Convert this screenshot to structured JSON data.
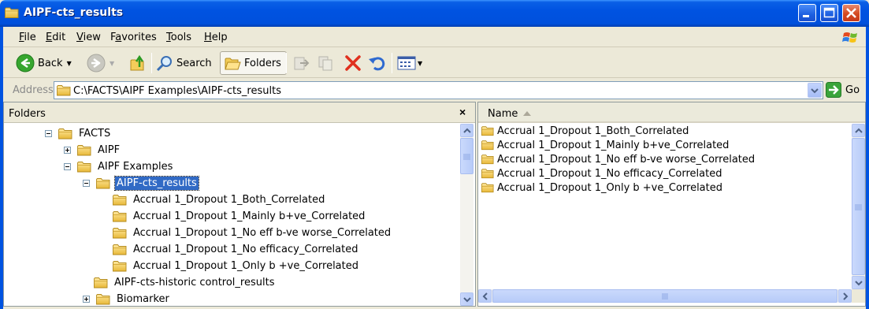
{
  "window": {
    "title": "AIPF-cts_results"
  },
  "menu": [
    "File",
    "Edit",
    "View",
    "Favorites",
    "Tools",
    "Help"
  ],
  "menu_underline": [
    "F",
    "E",
    "V",
    "a",
    "T",
    "H"
  ],
  "toolbar": {
    "back_label": "Back",
    "search_label": "Search",
    "folders_label": "Folders"
  },
  "address": {
    "label": "Address",
    "path": "C:\\FACTS\\AIPF Examples\\AIPF-cts_results",
    "go_label": "Go"
  },
  "folders_pane": {
    "title": "Folders",
    "close_glyph": "×",
    "tree": [
      {
        "label": "FACTS",
        "expander": "minus"
      },
      {
        "label": "AIPF",
        "expander": "plus"
      },
      {
        "label": "AIPF Examples",
        "expander": "minus"
      },
      {
        "label": "AIPF-cts_results",
        "expander": "minus",
        "selected": true
      },
      {
        "label": "Accrual 1_Dropout 1_Both_Correlated",
        "expander": "none"
      },
      {
        "label": "Accrual 1_Dropout 1_Mainly b+ve_Correlated",
        "expander": "none"
      },
      {
        "label": "Accrual 1_Dropout 1_No eff b-ve worse_Correlated",
        "expander": "none"
      },
      {
        "label": "Accrual 1_Dropout 1_No efficacy_Correlated",
        "expander": "none"
      },
      {
        "label": "Accrual 1_Dropout 1_Only b +ve_Correlated",
        "expander": "none"
      },
      {
        "label": "AIPF-cts-historic control_results",
        "expander": "none"
      },
      {
        "label": "Biomarker",
        "expander": "plus"
      }
    ]
  },
  "file_list": {
    "column_name": "Name",
    "items": [
      "Accrual 1_Dropout 1_Both_Correlated",
      "Accrual 1_Dropout 1_Mainly b+ve_Correlated",
      "Accrual 1_Dropout 1_No eff b-ve worse_Correlated",
      "Accrual 1_Dropout 1_No efficacy_Correlated",
      "Accrual 1_Dropout 1_Only b +ve_Correlated"
    ]
  },
  "icons": {
    "folder": "folder-icon",
    "back": "back-arrow-icon",
    "forward": "forward-arrow-icon",
    "up": "up-folder-icon",
    "search": "search-icon",
    "folders": "folders-icon",
    "move_to": "move-to-icon",
    "copy_to": "copy-to-icon",
    "delete": "delete-icon",
    "undo": "undo-icon",
    "views": "views-icon",
    "go": "go-arrow-icon"
  },
  "colors": {
    "titlebar": "#0053e1",
    "selection": "#316ac5",
    "folder": "#f3cd5a",
    "delete": "#e0301e"
  }
}
